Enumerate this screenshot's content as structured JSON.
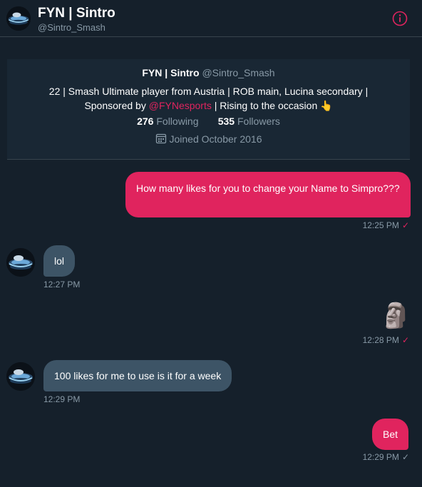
{
  "header": {
    "title": "FYN | Sintro",
    "handle": "@Sintro_Smash"
  },
  "profile": {
    "name": "FYN | Sintro",
    "handle": "@Sintro_Smash",
    "bio_line1": "22 | Smash Ultimate player from Austria | ROB main, Lucina secondary |",
    "bio_line2_pre": "Sponsored by ",
    "bio_link": "@FYNesports",
    "bio_line2_post": " | Rising to the occasion 👆",
    "following_count": "276",
    "following_label": "Following",
    "followers_count": "535",
    "followers_label": "Followers",
    "joined": "Joined October 2016"
  },
  "messages": [
    {
      "text": "How many likes for you to change your Name to Simpro???",
      "time": "12:25 PM",
      "direction": "out",
      "status": "✓"
    },
    {
      "text": "lol",
      "time": "12:27 PM",
      "direction": "in"
    },
    {
      "text": "🗿",
      "time": "12:28 PM",
      "direction": "out",
      "status": "✓"
    },
    {
      "text": "100 likes for me to use is it for a week",
      "time": "12:29 PM",
      "direction": "in"
    },
    {
      "text": "Bet",
      "time": "12:29 PM",
      "direction": "out",
      "status": "✓"
    }
  ],
  "colors": {
    "background": "#15202b",
    "accent": "#e0245e",
    "incoming_bubble": "#3d5466",
    "secondary_text": "#8899a6"
  },
  "icons": {
    "info": "info-icon",
    "calendar": "calendar-icon",
    "check": "check-icon"
  }
}
